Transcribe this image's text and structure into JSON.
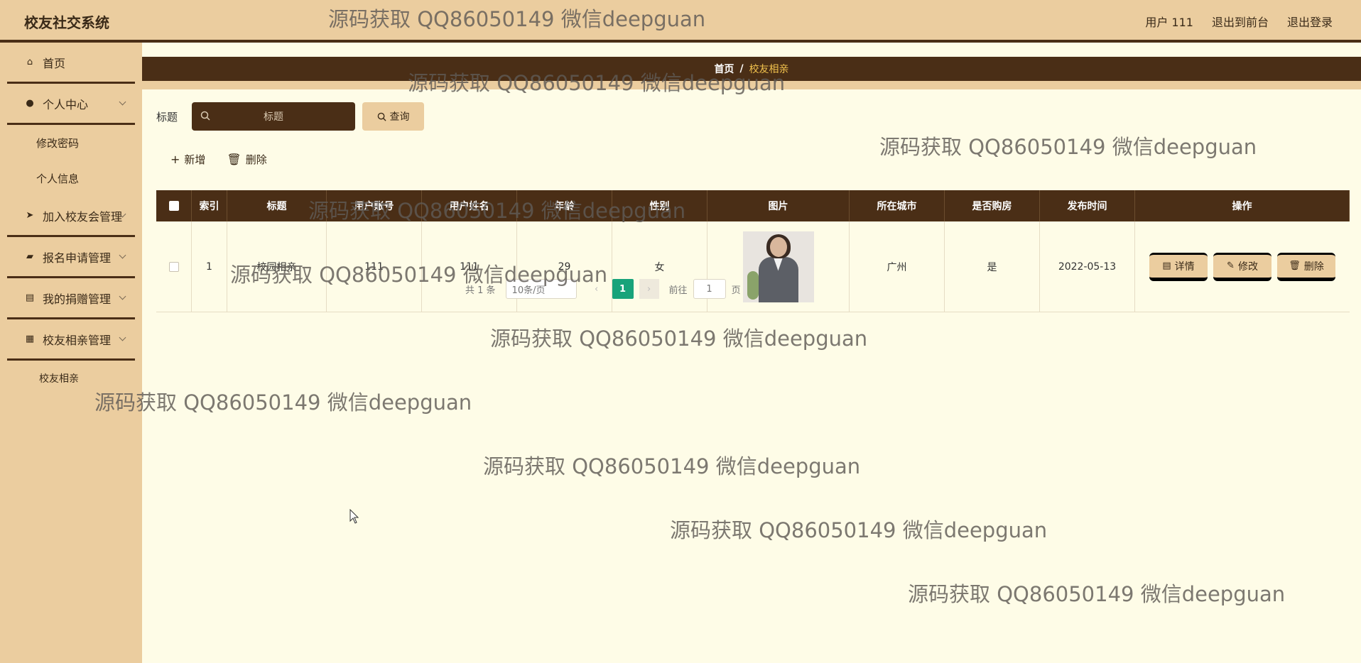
{
  "header": {
    "brand": "校友社交系统",
    "user_label": "用户 111",
    "to_front": "退出到前台",
    "logout": "退出登录"
  },
  "sidebar": {
    "items": [
      {
        "label": "首页",
        "icon": "home-icon"
      },
      {
        "label": "个人中心",
        "icon": "user-icon",
        "children": [
          "修改密码",
          "个人信息"
        ]
      },
      {
        "label": "加入校友会管理",
        "icon": "send-icon"
      },
      {
        "label": "报名申请管理",
        "icon": "briefcase-icon"
      },
      {
        "label": "我的捐赠管理",
        "icon": "clipboard-icon"
      },
      {
        "label": "校友相亲管理",
        "icon": "grid-icon",
        "children": [
          "校友相亲"
        ]
      }
    ]
  },
  "breadcrumb": {
    "home": "首页",
    "separator": "/",
    "current": "校友相亲"
  },
  "search": {
    "label": "标题",
    "placeholder": "标题",
    "button": "查询"
  },
  "actions": {
    "add": "新增",
    "delete": "删除"
  },
  "table": {
    "headers": [
      "索引",
      "标题",
      "用户账号",
      "用户姓名",
      "年龄",
      "性别",
      "图片",
      "所在城市",
      "是否购房",
      "发布时间",
      "操作"
    ],
    "rows": [
      {
        "index": "1",
        "title": "校园相亲",
        "account": "111",
        "name": "111",
        "age": "29",
        "gender": "女",
        "city": "广州",
        "house": "是",
        "published": "2022-05-13"
      }
    ],
    "ops": {
      "detail": "详情",
      "edit": "修改",
      "delete": "删除"
    }
  },
  "pagination": {
    "total": "共 1 条",
    "page_size": "10条/页",
    "current_page": "1",
    "goto_label": "前往",
    "goto_value": "1",
    "page_unit": "页"
  },
  "watermark": "源码获取 QQ86050149 微信deepguan",
  "colors": {
    "brown": "#4a2e16",
    "tan": "#ebcd9f",
    "cream": "#fefce7",
    "accent": "#f2c24d",
    "page_active": "#18a37a"
  }
}
